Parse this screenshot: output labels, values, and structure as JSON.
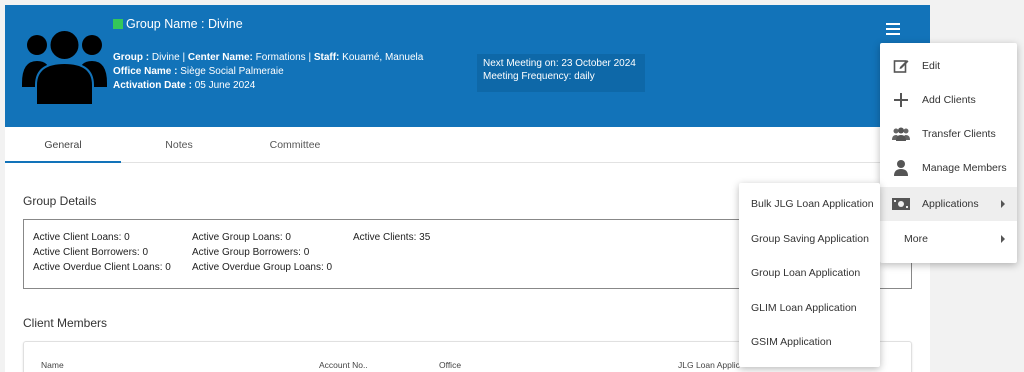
{
  "group": {
    "name_line": "Group Name : Divine",
    "group_label": "Group :",
    "group_value": "Divine",
    "center_label": "Center Name:",
    "center_value": "Formations",
    "staff_label": "Staff:",
    "staff_value": "Kouamé, Manuela",
    "office_label": "Office Name :",
    "office_value": "Siège Social Palmeraie",
    "activation_label": "Activation Date :",
    "activation_value": "05 June 2024",
    "status_color": "#34c759"
  },
  "meeting": {
    "next": "Next Meeting on: 23 October 2024",
    "frequency": "Meeting Frequency: daily"
  },
  "tabs": [
    {
      "label": "General",
      "active": true
    },
    {
      "label": "Notes",
      "active": false
    },
    {
      "label": "Committee",
      "active": false
    }
  ],
  "group_details": {
    "title": "Group Details",
    "col1": [
      "Active Client Loans: 0",
      "Active Client Borrowers: 0",
      "Active Overdue Client Loans: 0"
    ],
    "col2": [
      "Active Group Loans: 0",
      "Active Group Borrowers: 0",
      "Active Overdue Group Loans: 0"
    ],
    "col3": [
      "Active Clients: 35"
    ]
  },
  "client_members": {
    "title": "Client Members",
    "columns": [
      "Name",
      "Account No..",
      "Office",
      "JLG Loan Applic"
    ]
  },
  "actions_menu": {
    "items": [
      {
        "label": "Edit",
        "icon": "edit-icon"
      },
      {
        "label": "Add Clients",
        "icon": "plus-icon"
      },
      {
        "label": "Transfer Clients",
        "icon": "people-icon"
      },
      {
        "label": "Manage Members",
        "icon": "person-icon"
      },
      {
        "label": "Applications",
        "icon": "money-icon"
      },
      {
        "label": "More",
        "icon": ""
      }
    ]
  },
  "applications_submenu": {
    "items": [
      "Bulk JLG Loan Application",
      "Group Saving Application",
      "Group Loan Application",
      "GLIM Loan Application",
      "GSIM Application"
    ]
  },
  "colors": {
    "header_bg": "#1273b9",
    "accent": "#1273b9"
  }
}
